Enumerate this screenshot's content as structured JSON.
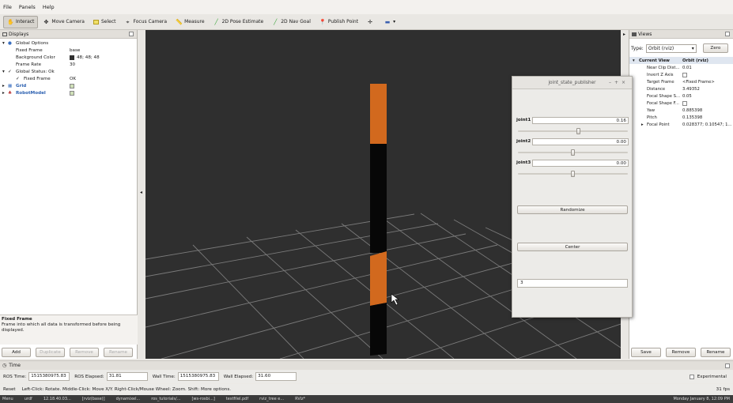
{
  "menubar": {
    "items": [
      "File",
      "Panels",
      "Help"
    ]
  },
  "toolbar": {
    "tools": [
      {
        "label": "Interact",
        "icon": "hand-icon",
        "active": true
      },
      {
        "label": "Move Camera",
        "icon": "move-camera-icon"
      },
      {
        "label": "Select",
        "icon": "select-icon"
      },
      {
        "label": "Focus Camera",
        "icon": "focus-icon"
      },
      {
        "label": "Measure",
        "icon": "ruler-icon"
      },
      {
        "label": "2D Pose Estimate",
        "icon": "green-arrow-icon"
      },
      {
        "label": "2D Nav Goal",
        "icon": "green-arrow-icon"
      },
      {
        "label": "Publish Point",
        "icon": "pin-icon"
      }
    ]
  },
  "displays": {
    "title": "Displays",
    "global_options": "Global Options",
    "fixed_frame_label": "Fixed Frame",
    "fixed_frame_value": "base",
    "background_color_label": "Background Color",
    "background_color_value": "48; 48; 48",
    "frame_rate_label": "Frame Rate",
    "frame_rate_value": "30",
    "global_status": "Global Status: Ok",
    "fixed_frame_status_label": "Fixed Frame",
    "fixed_frame_status_value": "OK",
    "grid_label": "Grid",
    "robot_model_label": "RobotModel",
    "desc_title": "Fixed Frame",
    "desc_text": "Frame into which all data is transformed before being displayed.",
    "buttons": {
      "add": "Add",
      "duplicate": "Duplicate",
      "remove": "Remove",
      "rename": "Rename"
    }
  },
  "views": {
    "title": "Views",
    "type_label": "Type:",
    "type_value": "Orbit (rviz)",
    "zero_button": "Zero",
    "rows": [
      {
        "label": "Current View",
        "value": "Orbit (rviz)",
        "head": true
      },
      {
        "label": "Near Clip Dist...",
        "value": "0.01"
      },
      {
        "label": "Invert Z Axis",
        "value": "",
        "check": true
      },
      {
        "label": "Target Frame",
        "value": "<Fixed Frame>"
      },
      {
        "label": "Distance",
        "value": "3.49352"
      },
      {
        "label": "Focal Shape S...",
        "value": "0.05"
      },
      {
        "label": "Focal Shape F...",
        "value": "",
        "check": true
      },
      {
        "label": "Yaw",
        "value": "0.885398"
      },
      {
        "label": "Pitch",
        "value": "0.135398"
      },
      {
        "label": "Focal Point",
        "value": "0.028377; 0.10547; 1..."
      }
    ],
    "buttons": {
      "save": "Save",
      "remove": "Remove",
      "rename": "Rename"
    }
  },
  "jsp": {
    "title": "joint_state_publisher",
    "joints": [
      {
        "name": "joint1",
        "value": "0.16",
        "level": 0.55
      },
      {
        "name": "joint2",
        "value": "0.00",
        "level": 0.5
      },
      {
        "name": "joint3",
        "value": "0.00",
        "level": 0.5
      }
    ],
    "randomize": "Randomize",
    "center": "Center",
    "spin_value": "3"
  },
  "time": {
    "title": "Time",
    "ros_time_label": "ROS Time:",
    "ros_time_value": "1515380975.83",
    "ros_elapsed_label": "ROS Elapsed:",
    "ros_elapsed_value": "31.81",
    "wall_time_label": "Wall Time:",
    "wall_time_value": "1515380975.83",
    "wall_elapsed_label": "Wall Elapsed:",
    "wall_elapsed_value": "31.60",
    "experimental": "Experimental"
  },
  "status": {
    "reset": "Reset",
    "hint": "Left-Click: Rotate.  Middle-Click: Move X/Y.  Right-Click/Mouse Wheel: Zoom.  Shift: More options.",
    "fps": "31 fps"
  },
  "taskbar": {
    "items": [
      "Menu",
      "urdf",
      "12.18.40.03...",
      "[rviz(base)]",
      "dynamixel...",
      "ros_tutorials/...",
      "[ws-rosbi...]",
      "testfilel.pdf",
      "rviz_tree e...",
      "RViz*"
    ],
    "clock": "Monday January 8, 12:09 PM"
  },
  "colors": {
    "view_bg": "#303030",
    "link_orange": "#d2691e",
    "link_black": "#050505",
    "grid_line": "#8a8a8a"
  }
}
